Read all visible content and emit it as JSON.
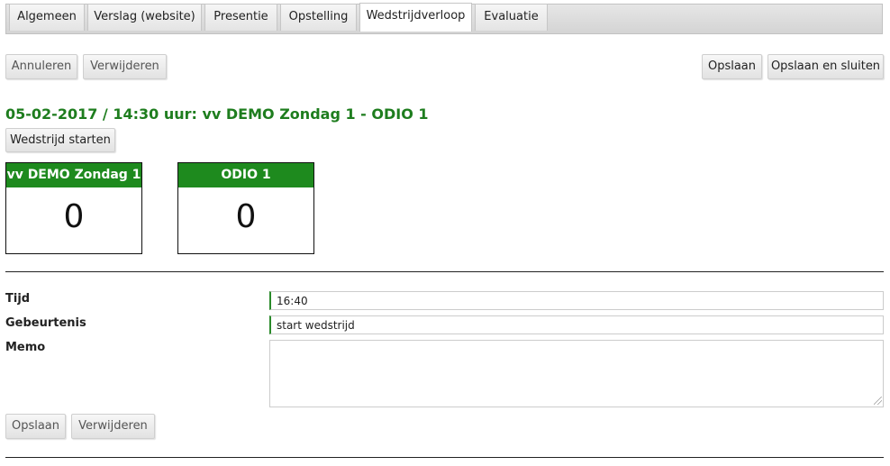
{
  "tabs": [
    {
      "label": "Algemeen"
    },
    {
      "label": "Verslag (website)"
    },
    {
      "label": "Presentie"
    },
    {
      "label": "Opstelling"
    },
    {
      "label": "Wedstrijdverloop",
      "active": true
    },
    {
      "label": "Evaluatie"
    }
  ],
  "toolbar": {
    "cancel_label": "Annuleren",
    "delete_label": "Verwijderen",
    "save_label": "Opslaan",
    "save_close_label": "Opslaan en sluiten"
  },
  "match": {
    "title": "05-02-2017 / 14:30 uur: vv DEMO Zondag 1 - ODIO 1",
    "start_label": "Wedstrijd starten",
    "home": {
      "name": "vv DEMO Zondag 1",
      "score": "0"
    },
    "away": {
      "name": "ODIO 1",
      "score": "0"
    }
  },
  "event_form": {
    "time_label": "Tijd",
    "time_value": "16:40",
    "event_label": "Gebeurtenis",
    "event_value": "start wedstrijd",
    "memo_label": "Memo",
    "memo_value": "",
    "save_label": "Opslaan",
    "delete_label": "Verwijderen"
  },
  "colors": {
    "accent_green": "#1e8a1e",
    "title_green": "#1e7d1e"
  }
}
